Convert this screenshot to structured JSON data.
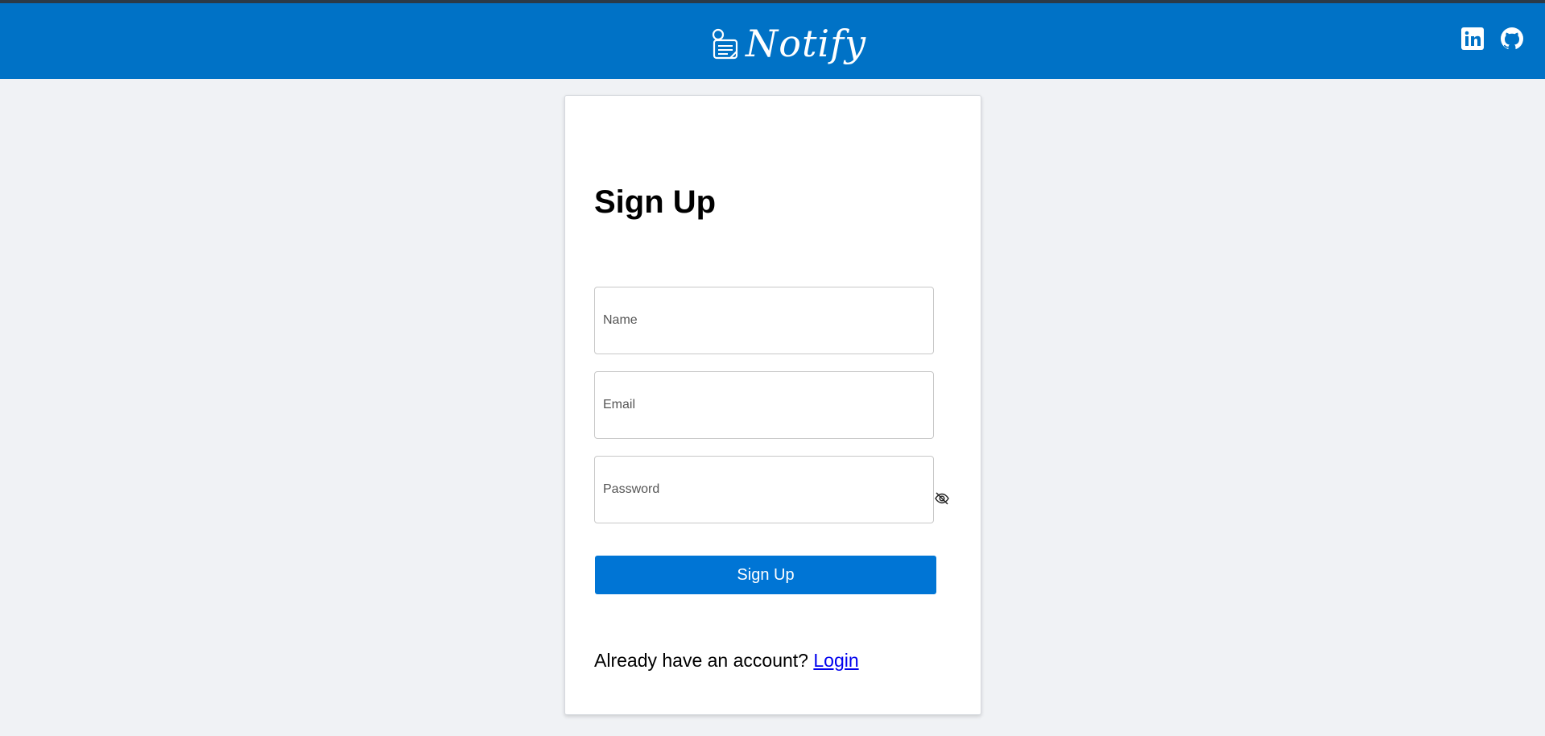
{
  "navbar": {
    "brand_name": "Notify",
    "brand_icon": "notepad-icon",
    "background_color": "#0072c6",
    "social_links": [
      {
        "icon": "linkedin-icon"
      },
      {
        "icon": "github-icon"
      }
    ]
  },
  "signup_form": {
    "title": "Sign Up",
    "name_placeholder": "Name",
    "email_placeholder": "Email",
    "password_placeholder": "Password",
    "password_toggle_icon": "eye-slash-icon",
    "submit_label": "Sign Up",
    "submit_color": "#0075d5",
    "login_prompt": "Already have an account? ",
    "login_link_label": "Login"
  }
}
